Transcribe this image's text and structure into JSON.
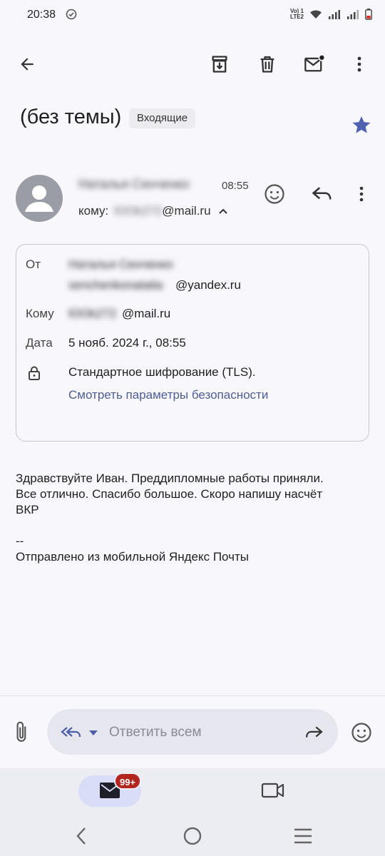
{
  "status_bar": {
    "time": "20:38",
    "volte_top": "Vo) 1",
    "volte_bottom": "LTE2"
  },
  "email": {
    "subject": "(без темы)",
    "label": "Входящие",
    "sender_name": "Наталья Сенченко",
    "time": "08:55",
    "to_prefix": "кому:",
    "to_hidden": "lOOk272",
    "to_domain": "@mail.ru"
  },
  "details": {
    "from_label": "От",
    "from_name": "Наталья Сенченко",
    "from_user": "senchenkonatalia",
    "from_domain": "@yandex.ru",
    "to_label": "Кому",
    "to_user": "lOOk272",
    "to_domain": "@mail.ru",
    "date_label": "Дата",
    "date_value": "5 нояб. 2024 г., 08:55",
    "encryption": "Стандартное шифрование (TLS).",
    "security_link": "Смотреть параметры безопасности"
  },
  "body": {
    "line1": "Здравствуйте Иван. Преддипломные работы приняли.",
    "line2": "Все отлично. Спасибо большое. Скоро напишу насчёт",
    "line3": "ВКР",
    "sig_sep": "--",
    "signature": "Отправлено из мобильной Яндекс Почты"
  },
  "compose": {
    "reply_placeholder": "Ответить всем"
  },
  "nav": {
    "mail_badge": "99+"
  },
  "colors": {
    "accent_star": "#4d63b0",
    "badge": "#b3261e",
    "link": "#4d5e96"
  }
}
